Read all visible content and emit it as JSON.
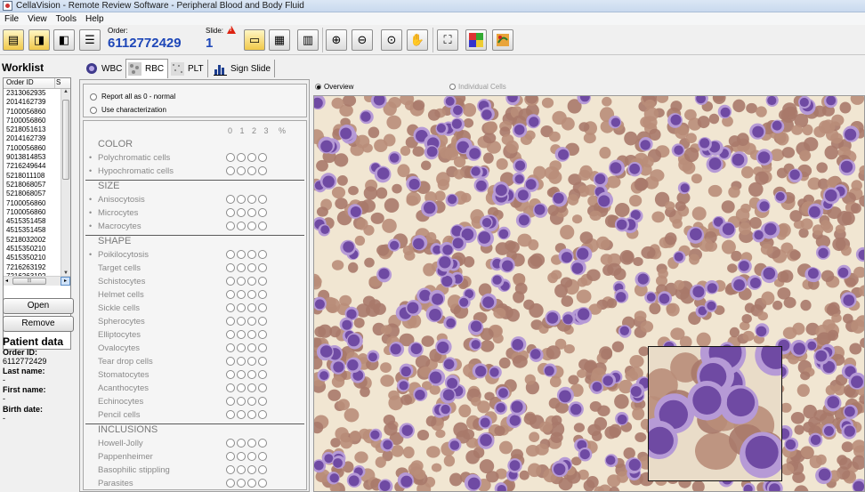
{
  "window": {
    "title": "CellaVision - Remote Review Software - Peripheral Blood and Body Fluid"
  },
  "menu": [
    "File",
    "View",
    "Tools",
    "Help"
  ],
  "toolbar": {
    "order_label": "Order:",
    "order_value": "6112772429",
    "slide_label": "Slide:",
    "slide_value": "1",
    "buttons": [
      {
        "name": "open-worklist-icon"
      },
      {
        "name": "open-order-icon"
      },
      {
        "name": "save-order-icon"
      },
      {
        "name": "report-icon"
      },
      {
        "name": "folder-open-icon"
      },
      {
        "name": "compare-icon"
      },
      {
        "name": "statistics-icon"
      },
      {
        "name": "zoom-in-icon"
      },
      {
        "name": "zoom-out-icon"
      },
      {
        "name": "zoom-fit-icon"
      },
      {
        "name": "pan-hand-icon"
      },
      {
        "name": "fullscreen-icon"
      },
      {
        "name": "color-adjust-icon"
      },
      {
        "name": "rotate-color-icon"
      }
    ]
  },
  "worklist": {
    "title": "Worklist",
    "column_order": "Order ID",
    "column_status": "S",
    "items": [
      "2313062935",
      "2014162739",
      "7100056860",
      "7100056860",
      "5218051613",
      "2014162739",
      "7100056860",
      "9013814853",
      "7216249644",
      "5218011108",
      "5218068057",
      "5218068057",
      "7100056860",
      "7100056860",
      "4515351458",
      "4515351458",
      "5218032002",
      "4515350210",
      "4515350210",
      "7216263192",
      "7216263192"
    ],
    "status_marks": [
      "",
      "",
      "",
      "",
      "",
      "",
      "",
      "",
      "",
      "",
      "",
      "",
      "",
      "",
      "",
      "",
      "",
      "",
      "",
      "",
      ""
    ],
    "open_label": "Open",
    "remove_label": "Remove"
  },
  "patient": {
    "title": "Patient data",
    "order_id_label": "Order ID:",
    "order_id_value": "6112772429",
    "last_name_label": "Last name:",
    "last_name_value": "-",
    "first_name_label": "First name:",
    "first_name_value": "-",
    "birth_date_label": "Birth date:",
    "birth_date_value": "-"
  },
  "tabs": [
    {
      "label": "WBC",
      "icon": "wbc-cell-icon"
    },
    {
      "label": "RBC",
      "icon": "rbc-cell-icon"
    },
    {
      "label": "PLT",
      "icon": "plt-cell-icon"
    },
    {
      "label": "Sign Slide",
      "icon": "sign-slide-chart-icon"
    }
  ],
  "active_tab": "RBC",
  "characterization": {
    "option_normal": "Report all as 0 - normal",
    "option_characterization": "Use characterization",
    "grade_header": "0 1 2 3",
    "percent_header": "%",
    "sections": [
      {
        "title": "COLOR",
        "items": [
          {
            "label": "Polychromatic cells",
            "dot": true
          },
          {
            "label": "Hypochromatic cells",
            "dot": true
          }
        ]
      },
      {
        "title": "SIZE",
        "items": [
          {
            "label": "Anisocytosis",
            "dot": true
          },
          {
            "label": "Microcytes",
            "dot": true
          },
          {
            "label": "Macrocytes",
            "dot": true
          }
        ]
      },
      {
        "title": "SHAPE",
        "items": [
          {
            "label": "Poikilocytosis",
            "dot": true
          },
          {
            "label": "Target cells",
            "dot": false
          },
          {
            "label": "Schistocytes",
            "dot": false
          },
          {
            "label": "Helmet cells",
            "dot": false
          },
          {
            "label": "Sickle cells",
            "dot": false
          },
          {
            "label": "Spherocytes",
            "dot": false
          },
          {
            "label": "Elliptocytes",
            "dot": false
          },
          {
            "label": "Ovalocytes",
            "dot": false
          },
          {
            "label": "Tear drop cells",
            "dot": false
          },
          {
            "label": "Stomatocytes",
            "dot": false
          },
          {
            "label": "Acanthocytes",
            "dot": false
          },
          {
            "label": "Echinocytes",
            "dot": false
          },
          {
            "label": "Pencil cells",
            "dot": false
          }
        ]
      },
      {
        "title": "INCLUSIONS",
        "items": [
          {
            "label": "Howell-Jolly",
            "dot": false
          },
          {
            "label": "Pappenheimer",
            "dot": false
          },
          {
            "label": "Basophilic stippling",
            "dot": false
          },
          {
            "label": "Parasites",
            "dot": false
          }
        ]
      }
    ]
  },
  "viewer": {
    "overview_label": "Overview",
    "individual_label": "Individual Cells"
  },
  "colors": {
    "order_blue": "#1e47b8",
    "rbc": "#b98d79",
    "wbc": "#6f4aa3",
    "background": "#f1e6d2"
  }
}
